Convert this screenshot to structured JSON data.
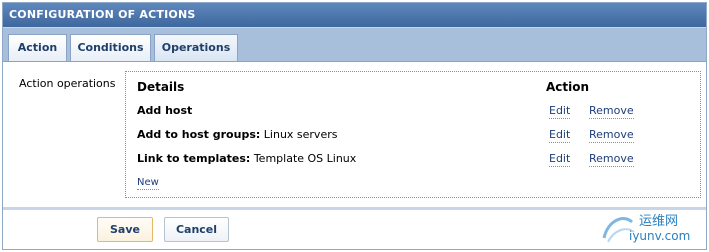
{
  "window": {
    "title": "CONFIGURATION OF ACTIONS"
  },
  "tabs": [
    {
      "label": "Action"
    },
    {
      "label": "Conditions"
    },
    {
      "label": "Operations"
    }
  ],
  "operations": {
    "section_label": "Action operations",
    "header_details": "Details",
    "header_action": "Action",
    "rows": [
      {
        "bold": "Add host",
        "detail": "",
        "edit": "Edit",
        "remove": "Remove"
      },
      {
        "bold": "Add to host groups:",
        "detail": "Linux servers",
        "edit": "Edit",
        "remove": "Remove"
      },
      {
        "bold": "Link to templates:",
        "detail": "Template OS Linux",
        "edit": "Edit",
        "remove": "Remove"
      }
    ],
    "new_link": "New"
  },
  "footer": {
    "save": "Save",
    "cancel": "Cancel"
  },
  "watermark": {
    "line1": "运维网",
    "line2": "iyunv.com"
  },
  "colors": {
    "title_bar": "#4a74aa",
    "tab_strip": "#a7bfda",
    "link": "#1d3d78"
  }
}
